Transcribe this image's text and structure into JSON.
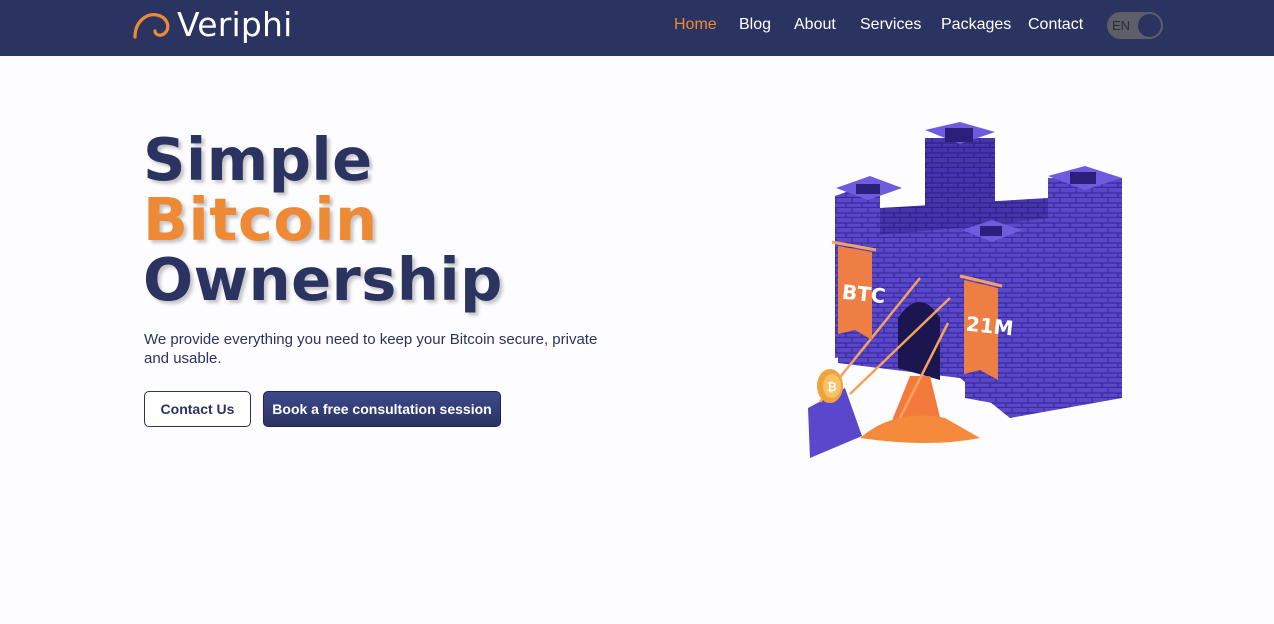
{
  "brand": {
    "name": "Veriphi",
    "logo_icon": "swirl-arc-icon"
  },
  "nav": {
    "items": [
      {
        "label": "Home",
        "active": true
      },
      {
        "label": "Blog",
        "active": false
      },
      {
        "label": "About",
        "active": false
      },
      {
        "label": "Services",
        "active": false
      },
      {
        "label": "Packages",
        "active": false
      },
      {
        "label": "Contact",
        "active": false
      }
    ],
    "language": "EN"
  },
  "hero": {
    "title_line1": "Simple",
    "title_line2": "Bitcoin",
    "title_line3": "Ownership",
    "subtitle": "We provide everything you need to keep your Bitcoin secure, private and usable.",
    "contact_label": "Contact Us",
    "book_label": "Book a free consultation session"
  },
  "illustration": {
    "banner_left": "BTC",
    "banner_right": "21M",
    "coin_icon": "bitcoin-coin-icon"
  },
  "colors": {
    "navbar": "#2b3361",
    "accent": "#ee8a35",
    "castle": "#5a47cc",
    "background": "#fdfcfe"
  }
}
